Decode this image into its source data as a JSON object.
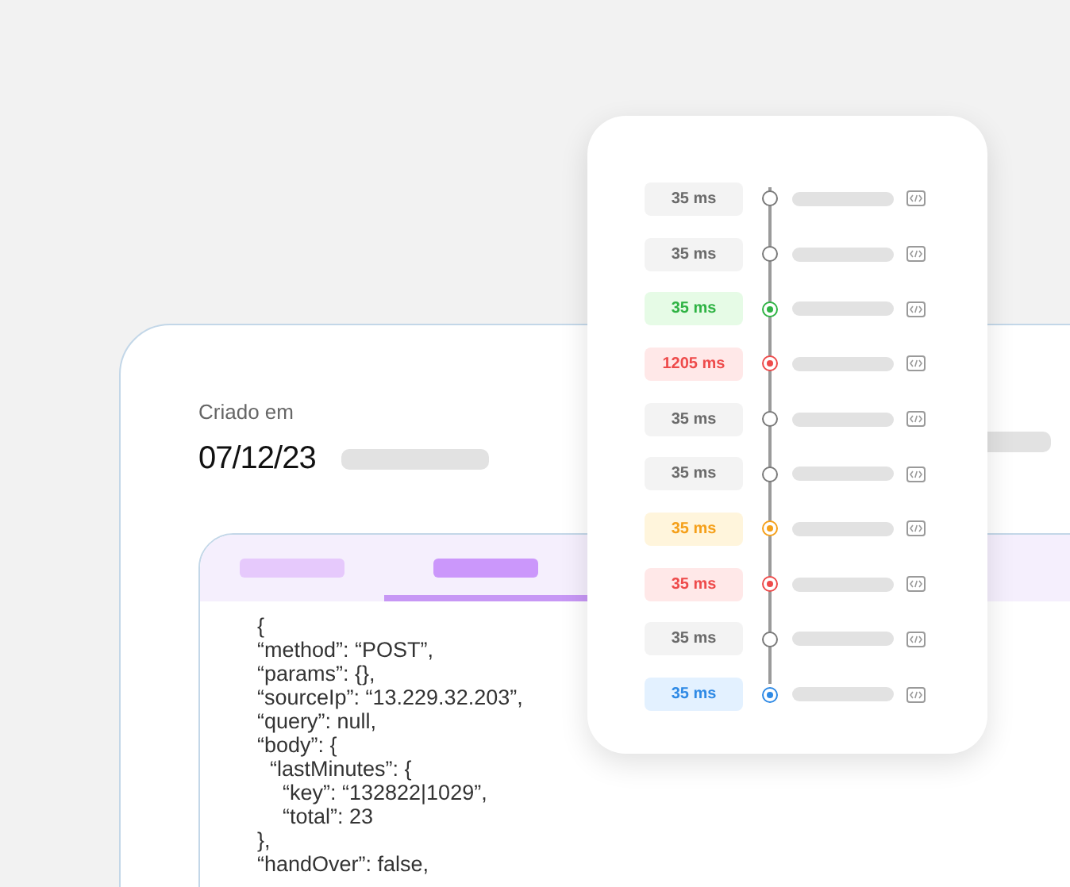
{
  "record": {
    "label": "Criado em",
    "date": "07/12/23",
    "tabs": [
      {
        "selected": false
      },
      {
        "selected": true
      }
    ],
    "code": [
      {
        "text": "{"
      },
      {
        "text": "“method”: “POST”,"
      },
      {
        "text": "“params”: {},"
      },
      {
        "text": "“sourceIp”: “13.229.32.203”,"
      },
      {
        "text": "“query”: null,"
      },
      {
        "text": "“body”: {",
        "children": [
          {
            "text": "“lastMinutes”: {",
            "children": [
              {
                "text": "“key”: “132822|1029”,"
              },
              {
                "text": "“total”: 23"
              }
            ]
          }
        ]
      },
      {
        "text": "},"
      },
      {
        "text": "“handOver”: false,"
      }
    ]
  },
  "timeline": [
    {
      "duration": "35 ms",
      "kind": "neutral"
    },
    {
      "duration": "35 ms",
      "kind": "neutral"
    },
    {
      "duration": "35 ms",
      "kind": "success"
    },
    {
      "duration": "1205 ms",
      "kind": "error"
    },
    {
      "duration": "35 ms",
      "kind": "neutral"
    },
    {
      "duration": "35 ms",
      "kind": "neutral"
    },
    {
      "duration": "35 ms",
      "kind": "warning"
    },
    {
      "duration": "35 ms",
      "kind": "error"
    },
    {
      "duration": "35 ms",
      "kind": "neutral"
    },
    {
      "duration": "35 ms",
      "kind": "info"
    }
  ]
}
